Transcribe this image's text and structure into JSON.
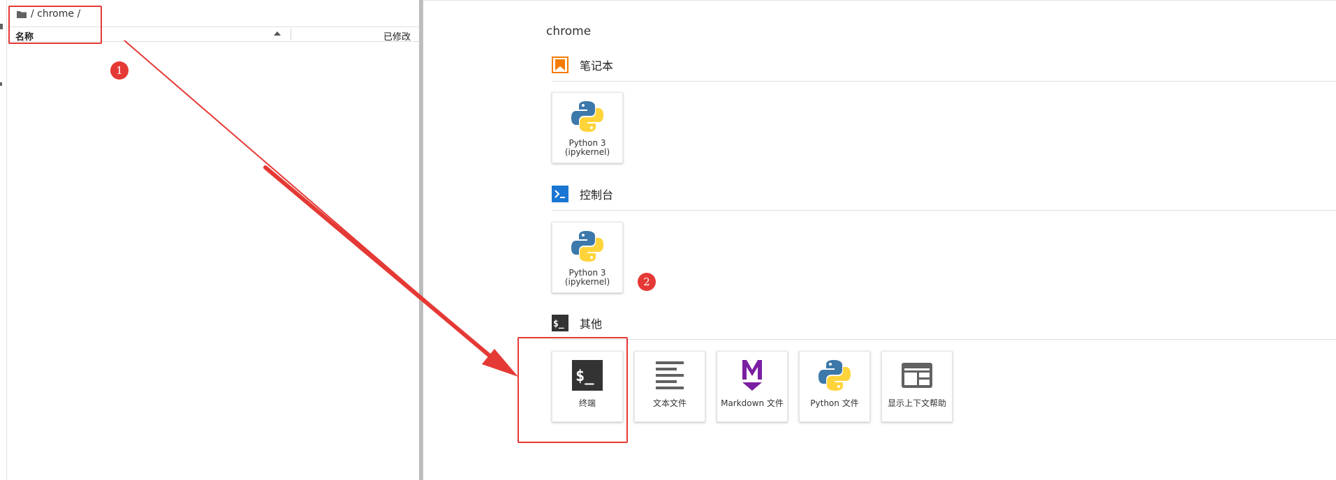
{
  "file_browser": {
    "breadcrumb": "/ chrome /",
    "column_name": "名称",
    "column_modified": "已修改"
  },
  "launcher": {
    "cwd": "chrome",
    "sections": {
      "notebook": {
        "title": "笔记本",
        "icon": "notebook-bookmark-icon",
        "cards": [
          {
            "line1": "Python 3",
            "line2": "(ipykernel)",
            "icon": "python-logo-icon"
          }
        ]
      },
      "console": {
        "title": "控制台",
        "icon": "console-prompt-icon",
        "cards": [
          {
            "line1": "Python 3",
            "line2": "(ipykernel)",
            "icon": "python-logo-icon"
          }
        ]
      },
      "other": {
        "title": "其他",
        "icon": "terminal-dollar-icon",
        "cards": [
          {
            "label": "终端",
            "icon": "terminal-icon"
          },
          {
            "label": "文本文件",
            "icon": "text-file-icon"
          },
          {
            "label": "Markdown 文件",
            "icon": "markdown-icon"
          },
          {
            "label": "Python 文件",
            "icon": "python-logo-icon"
          },
          {
            "label": "显示上下文帮助",
            "icon": "context-help-icon"
          }
        ]
      }
    }
  },
  "annotations": {
    "badge_1": "1",
    "badge_2": "2",
    "color": "#e53935"
  },
  "colors": {
    "notebook_accent": "#f57c00",
    "console_accent": "#1976d2",
    "markdown_accent": "#7b1fa2",
    "terminal_dark": "#333333",
    "python_blue": "#3d78aa",
    "python_yellow": "#ffd43b"
  }
}
